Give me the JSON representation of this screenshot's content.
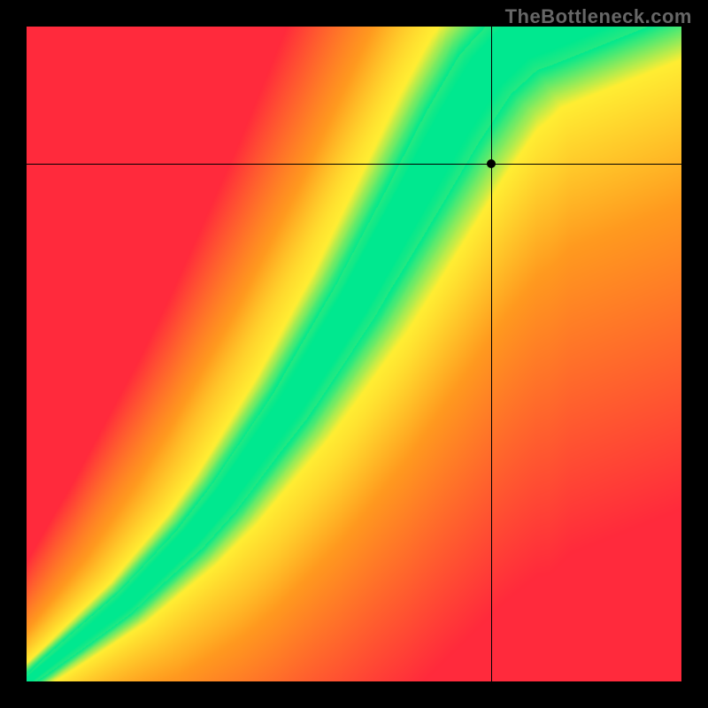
{
  "watermark": "TheBottleneck.com",
  "chart_data": {
    "type": "heatmap",
    "title": "",
    "xlabel": "",
    "ylabel": "",
    "xlim": [
      0,
      1
    ],
    "ylim": [
      0,
      1
    ],
    "grid": false,
    "legend": false,
    "marker": {
      "x": 0.71,
      "y": 0.79
    },
    "crosshair": {
      "x": 0.71,
      "y": 0.79
    },
    "optimal_curve": {
      "description": "Green optimal band following a superlinear curve from bottom-left to upper area; band is narrow near origin and widens toward top.",
      "points_x": [
        0.0,
        0.05,
        0.1,
        0.15,
        0.2,
        0.25,
        0.3,
        0.35,
        0.4,
        0.45,
        0.5,
        0.55,
        0.6,
        0.65,
        0.7,
        0.75,
        0.8
      ],
      "points_y": [
        0.0,
        0.04,
        0.08,
        0.12,
        0.17,
        0.22,
        0.28,
        0.35,
        0.42,
        0.5,
        0.58,
        0.67,
        0.76,
        0.85,
        0.93,
        0.98,
        1.0
      ],
      "band_halfwidth_start": 0.01,
      "band_halfwidth_end": 0.055
    },
    "color_stops": {
      "optimal": "#00e88f",
      "near": "#ffee33",
      "mid": "#ff9a1f",
      "far": "#ff2a3c"
    }
  },
  "layout": {
    "canvas_size": 740,
    "plot_offset": 30
  }
}
